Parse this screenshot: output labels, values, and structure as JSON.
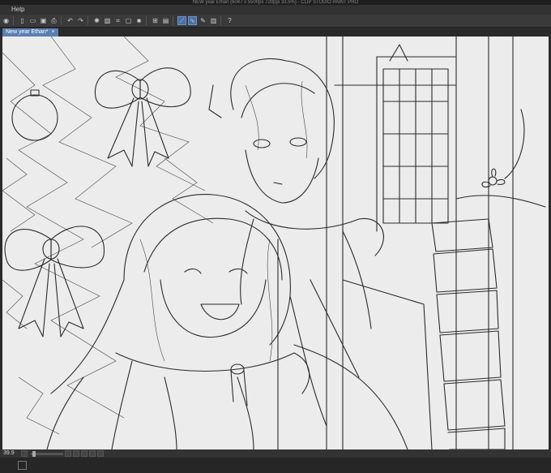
{
  "window": {
    "title": "NEW year Ethan  (6047 x 5500px 720ppi 33.5%)  - CLIP STUDIO PAINT PRO"
  },
  "menu": {
    "items": [
      "Help"
    ]
  },
  "document": {
    "tab_label": "New year Ethan*",
    "tab_close": "×"
  },
  "status": {
    "zoom": "39.9"
  },
  "toolbar": {
    "icons": [
      "navigator-icon",
      "new-file-icon",
      "open-icon",
      "save-icon",
      "print-icon",
      "undo-icon",
      "redo-icon",
      "spinner-icon",
      "transform-icon",
      "grid-icon",
      "ruler-icon",
      "pen-stabilize-icon",
      "layer-icon",
      "help-icon"
    ]
  }
}
